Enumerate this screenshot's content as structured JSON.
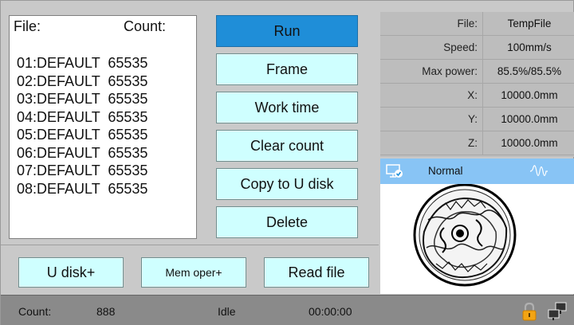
{
  "file_panel": {
    "file_header": "File:",
    "count_header": "Count:",
    "files": [
      "01:DEFAULT  65535",
      "02:DEFAULT  65535",
      "03:DEFAULT  65535",
      "04:DEFAULT  65535",
      "05:DEFAULT  65535",
      "06:DEFAULT  65535",
      "07:DEFAULT  65535",
      "08:DEFAULT  65535"
    ]
  },
  "actions": {
    "run": "Run",
    "frame": "Frame",
    "work_time": "Work time",
    "clear_count": "Clear count",
    "copy_to_u_disk": "Copy to U disk",
    "delete": "Delete"
  },
  "bottom_buttons": {
    "u_disk": "U disk+",
    "mem_oper": "Mem oper+",
    "read_file": "Read file"
  },
  "info": {
    "file_label": "File:",
    "file_value": "TempFile",
    "speed_label": "Speed:",
    "speed_value": "100mm/s",
    "max_power_label": "Max power:",
    "max_power_value": "85.5%/85.5%",
    "x_label": "X:",
    "x_value": "10000.0mm",
    "y_label": "Y:",
    "y_value": "10000.0mm",
    "z_label": "Z:",
    "z_value": "10000.0mm"
  },
  "status": {
    "mode": "Normal"
  },
  "statusbar": {
    "count_label": "Count:",
    "count_value": "888",
    "state": "Idle",
    "time": "00:00:00"
  },
  "icons": {
    "monitor": "monitor-check-icon",
    "waveform": "waveform-icon",
    "lock": "lock-icon",
    "network": "network-icon"
  },
  "colors": {
    "run_active": "#1f8ed8",
    "button_bg": "#cfffff",
    "status_strip": "#88c4f5"
  }
}
